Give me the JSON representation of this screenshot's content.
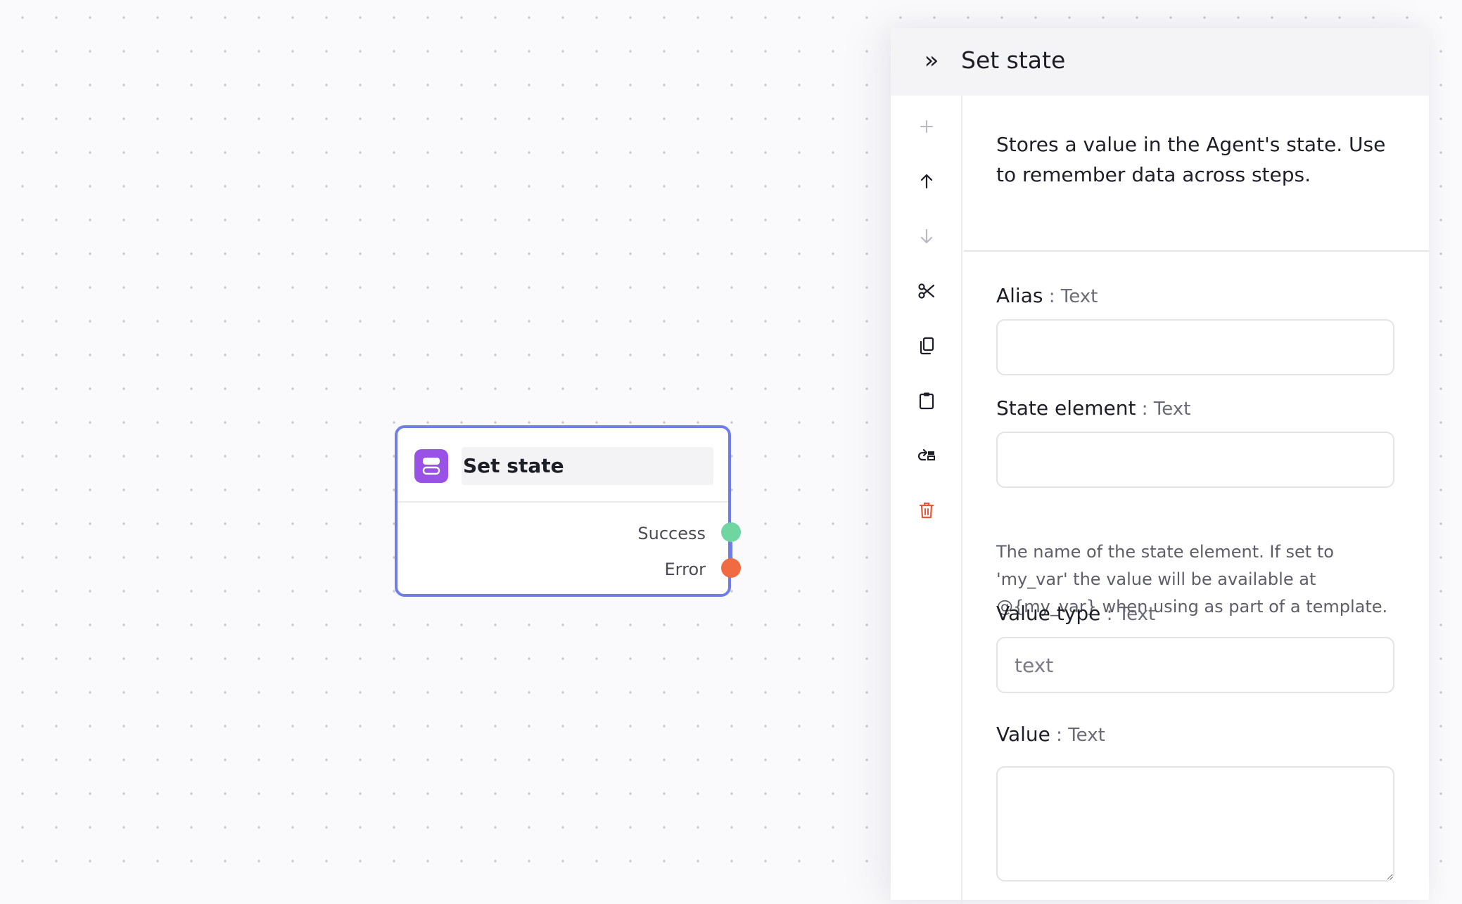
{
  "canvas": {
    "node": {
      "title": "Set state",
      "icon": "database-icon",
      "outputs": [
        {
          "label": "Success",
          "color": "#6fd6a2"
        },
        {
          "label": "Error",
          "color": "#f06a42"
        }
      ],
      "accent": "#6f7ee6",
      "icon_bg": "#9a52e6"
    }
  },
  "panel": {
    "collapse_label": "»",
    "title": "Set state",
    "toolbar": [
      {
        "name": "add-icon"
      },
      {
        "name": "arrow-up-icon"
      },
      {
        "name": "arrow-down-icon"
      },
      {
        "name": "cut-icon"
      },
      {
        "name": "copy-icon"
      },
      {
        "name": "paste-icon"
      },
      {
        "name": "replace-icon"
      },
      {
        "name": "delete-icon",
        "color": "#e8573a"
      }
    ],
    "description": "Stores a value in the Agent's state. Use to remember data across steps.",
    "fields": {
      "alias": {
        "label": "Alias",
        "sep": " : ",
        "type": "Text",
        "value": "",
        "placeholder": ""
      },
      "state_element": {
        "label": "State element",
        "sep": " : ",
        "type": "Text",
        "value": "",
        "placeholder": "",
        "help": "The name of the state element. If set to 'my_var' the value will be available at @{my_var} when using as part of a template."
      },
      "value_type": {
        "label": "Value type",
        "sep": " : ",
        "type": "Text",
        "value": "",
        "placeholder": "text"
      },
      "value": {
        "label": "Value",
        "sep": " : ",
        "type": "Text",
        "value": "",
        "placeholder": ""
      }
    }
  }
}
